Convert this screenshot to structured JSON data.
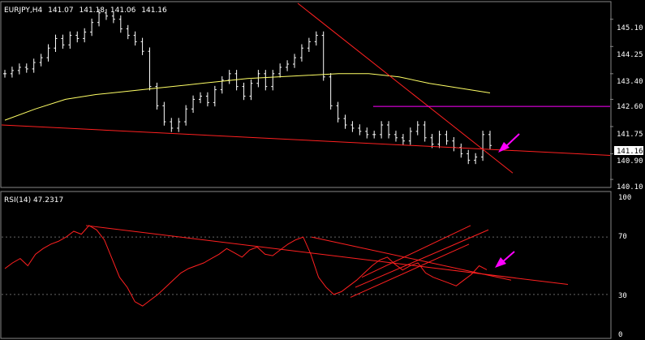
{
  "chart_data": [
    {
      "type": "line",
      "title": "EURJPY,H4",
      "ohlc_header": {
        "symbol": "EURJPY,H4",
        "open": "141.07",
        "high": "141.18",
        "low": "141.06",
        "close": "141.16"
      },
      "y_ticks": [
        "145.10",
        "144.25",
        "143.40",
        "142.60",
        "141.75",
        "140.90",
        "140.10"
      ],
      "ylim": [
        139.9,
        145.6
      ],
      "current_price": "141.16",
      "series": [
        {
          "values": [
            143.4,
            143.5,
            143.6,
            143.55,
            143.75,
            143.9,
            144.2,
            144.5,
            144.3,
            144.6,
            144.5,
            144.7,
            145.0,
            145.3,
            145.2,
            145.1,
            144.8,
            144.6,
            144.4,
            144.1,
            143.0,
            142.4,
            141.9,
            141.7,
            141.9,
            142.3,
            142.6,
            142.7,
            142.5,
            142.9,
            143.2,
            143.4,
            143.0,
            142.7,
            143.1,
            143.4,
            143.0,
            143.4,
            143.6,
            143.7,
            143.9,
            144.2,
            144.4,
            144.6,
            143.3,
            142.4,
            142.0,
            141.8,
            141.7,
            141.6,
            141.5,
            141.5,
            141.8,
            141.5,
            141.4,
            141.3,
            141.6,
            141.8,
            141.4,
            141.2,
            141.5,
            141.3,
            141.1,
            140.9,
            140.7,
            140.8,
            141.5,
            141.16
          ]
        },
        {
          "values": [
            141.95,
            142.3,
            142.6,
            142.75,
            142.85,
            142.95,
            143.05,
            143.15,
            143.25,
            143.3,
            143.35,
            143.4,
            143.4,
            143.3,
            143.1,
            142.95,
            142.8
          ]
        }
      ],
      "trendlines": [
        {
          "price_start": 141.8,
          "price_end": 140.85,
          "color": "#ff2020"
        },
        {
          "price_start": 145.6,
          "price_end": 140.3,
          "color": "#ff2020"
        },
        {
          "price_start": 142.38,
          "price_end": 142.38,
          "color": "#ff00ff"
        }
      ]
    },
    {
      "type": "line",
      "title": "RSI(14) 47.2317",
      "y_ticks": [
        "100",
        "70",
        "30",
        "0"
      ],
      "ylim": [
        0,
        100
      ],
      "levels": [
        70,
        30
      ],
      "series": [
        {
          "values": [
            48,
            52,
            55,
            50,
            58,
            62,
            65,
            67,
            70,
            74,
            72,
            78,
            75,
            68,
            55,
            42,
            35,
            25,
            22,
            26,
            30,
            35,
            40,
            45,
            48,
            50,
            52,
            55,
            58,
            62,
            59,
            56,
            61,
            63,
            58,
            57,
            61,
            65,
            68,
            70,
            58,
            42,
            35,
            30,
            32,
            36,
            40,
            45,
            50,
            54,
            56,
            51,
            47,
            50,
            52,
            45,
            42,
            40,
            38,
            36,
            40,
            44,
            50,
            47.2317
          ]
        }
      ],
      "trendlines": [
        {
          "rsi_start": 78,
          "rsi_end": 37,
          "color": "#ff2020"
        },
        {
          "rsi_start": 70,
          "rsi_end": 40,
          "color": "#ff2020"
        },
        {
          "rsi_start": 28,
          "rsi_end": 65,
          "color": "#ff2020"
        },
        {
          "rsi_start": 35,
          "rsi_end": 75,
          "color": "#ff2020"
        },
        {
          "rsi_start": 42,
          "rsi_end": 78,
          "color": "#ff2020"
        }
      ]
    }
  ],
  "colors": {
    "background": "#000000",
    "bars": "#ffffff",
    "moving_average": "#ffff66",
    "trendline": "#ff2020",
    "horizontal_line": "#ff00ff",
    "arrow": "#ff00ff",
    "rsi_line": "#ff2020",
    "grid": "#666666",
    "price_label_bg": "#ffffff"
  }
}
